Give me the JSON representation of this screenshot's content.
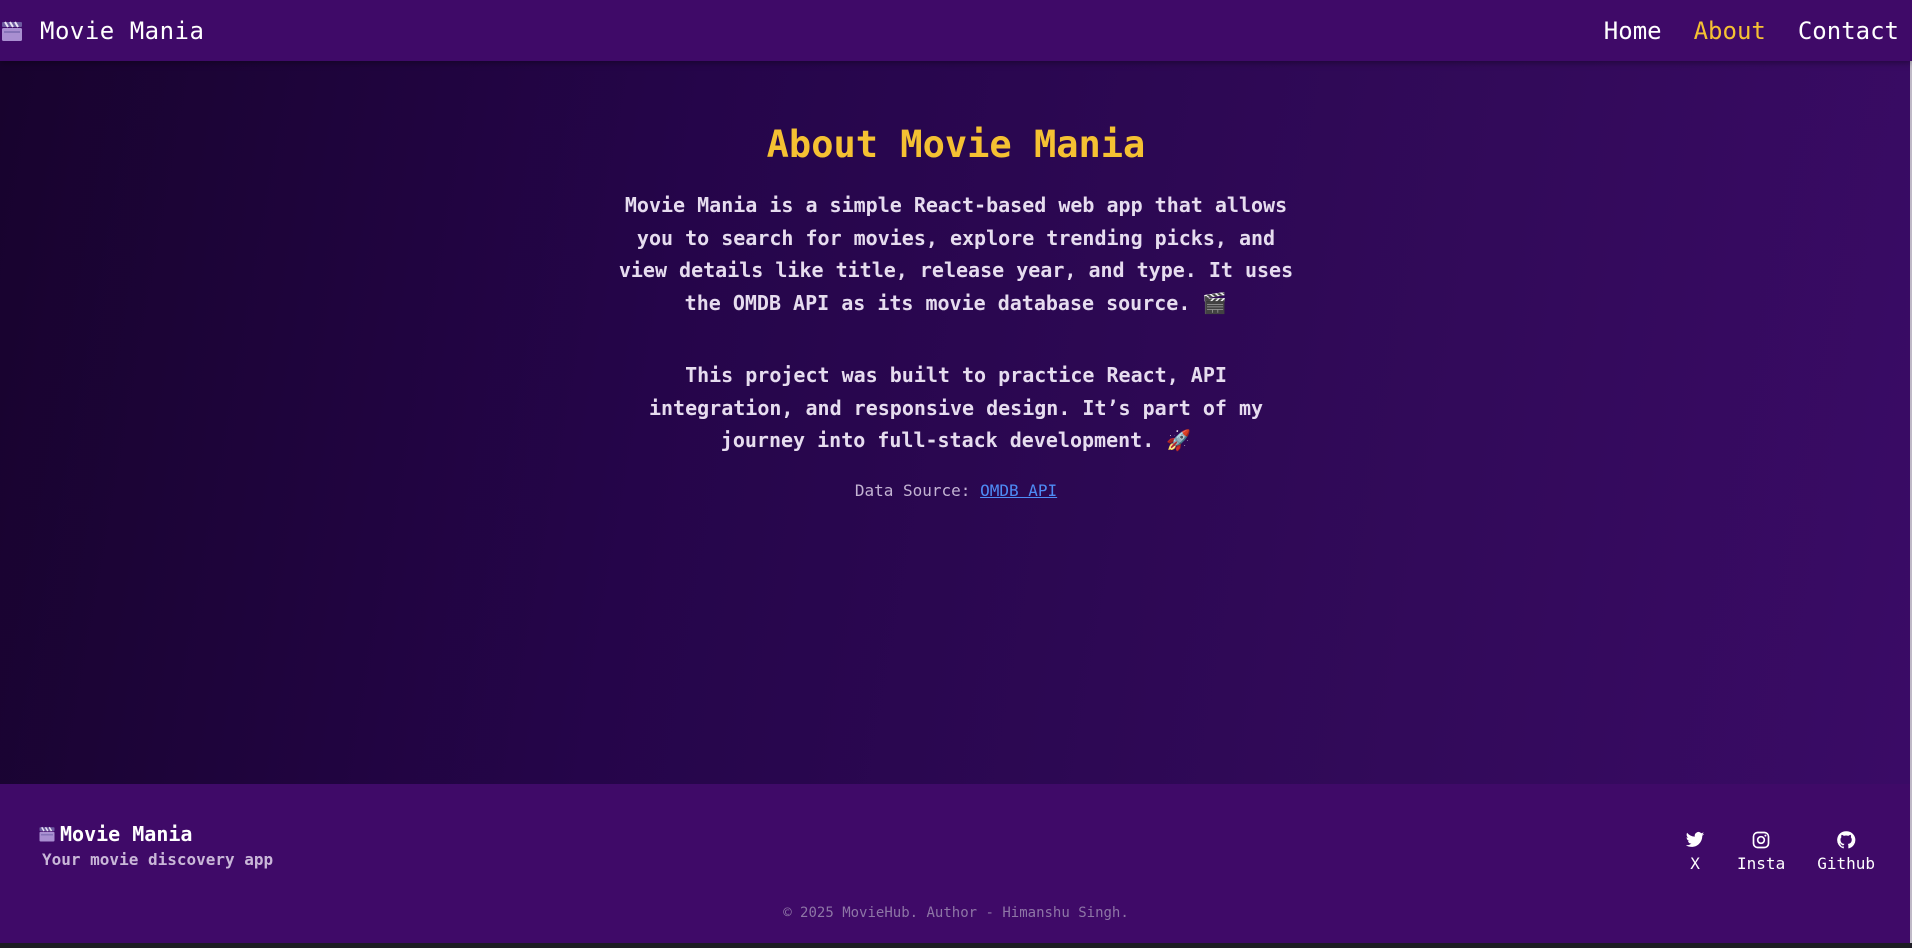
{
  "navbar": {
    "brand": "Movie Mania",
    "brand_icon": "clapperboard-icon",
    "links": [
      {
        "label": "Home",
        "active": false
      },
      {
        "label": "About",
        "active": true
      },
      {
        "label": "Contact",
        "active": false
      }
    ]
  },
  "about": {
    "title": "About Movie Mania",
    "paragraph1": "Movie Mania is a simple React-based web app that allows you to search for movies, explore trending picks, and view details like title, release year, and type. It uses the OMDB API as its movie database source. 🎬",
    "paragraph2": "This project was built to practice React, API integration, and responsive design. It’s part of my journey into full-stack development. 🚀",
    "source_label": "Data Source:",
    "source_link": "OMDB API"
  },
  "footer": {
    "brand": "Movie Mania",
    "tagline": "Your movie discovery app",
    "socials": [
      {
        "label": "X",
        "icon": "twitter-icon"
      },
      {
        "label": "Insta",
        "icon": "instagram-icon"
      },
      {
        "label": "Github",
        "icon": "github-icon"
      }
    ],
    "copyright": "© 2025 MovieHub. Author - Himanshu Singh."
  },
  "colors": {
    "accent": "#f5c132",
    "nav_bg": "#3f0a68",
    "link": "#4e8cf6"
  }
}
